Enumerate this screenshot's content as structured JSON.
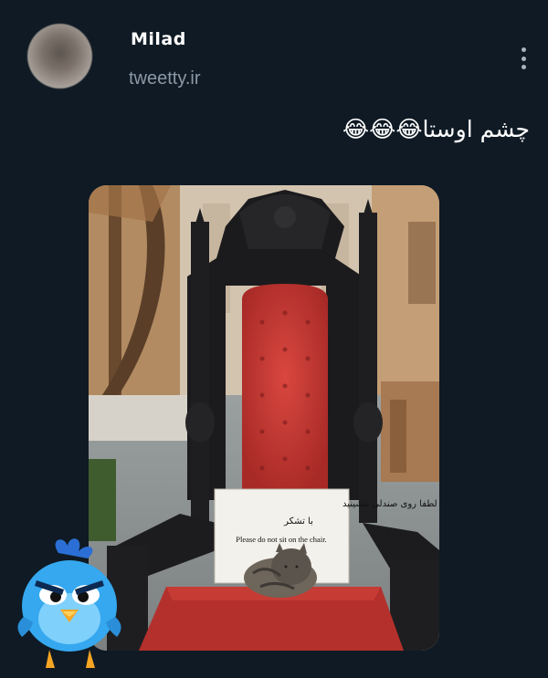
{
  "tweet": {
    "author_name": "Milad",
    "handle": "tweetty.ir",
    "text": "چشم اوستا😂😂😂"
  },
  "photo": {
    "sign_fa_line1": "لطفا روی صندلی ننشینید",
    "sign_fa_line2": "با تشکر",
    "sign_en": "Please do not sit on the chair."
  },
  "icons": {
    "more": "more-vertical-icon",
    "mascot": "angry-bird-mascot-icon"
  }
}
